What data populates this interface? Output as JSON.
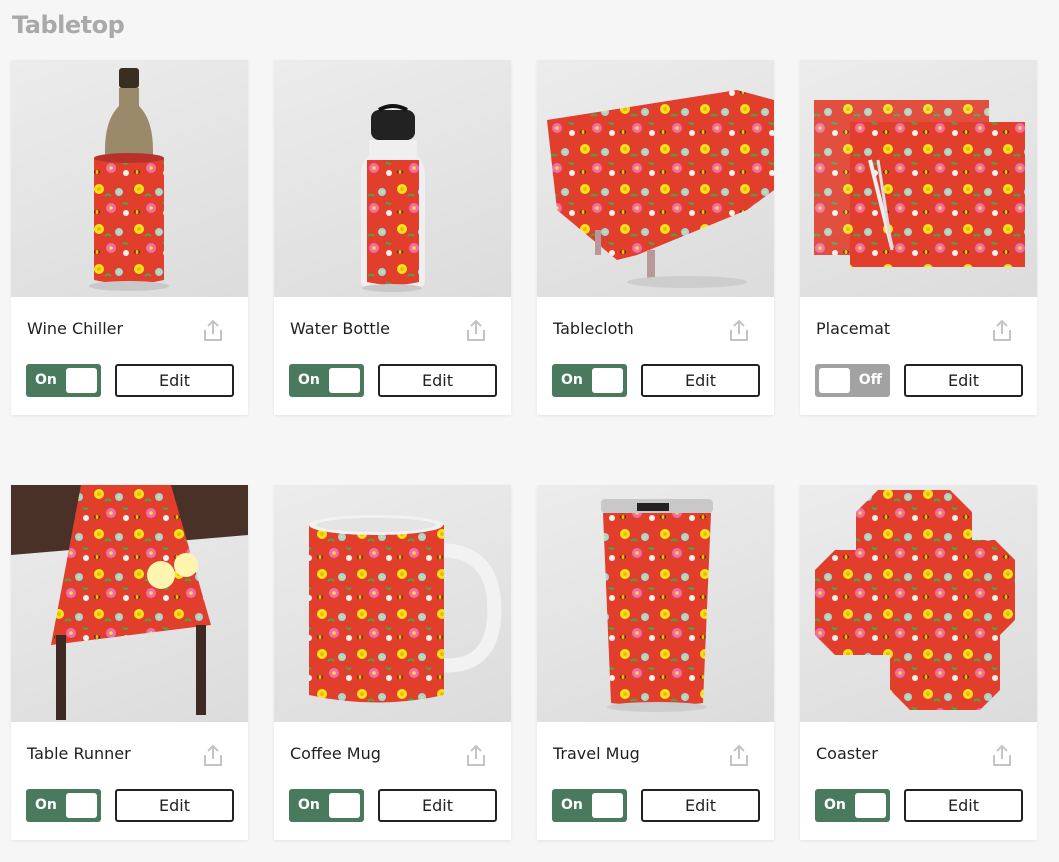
{
  "section": {
    "title": "Tabletop"
  },
  "colors": {
    "toggle_on": "#4a7a5e",
    "toggle_off": "#a2a2a2",
    "pattern_red": "#e13e2c",
    "pattern_yellow": "#f5e41a"
  },
  "products": [
    {
      "name": "Wine Chiller",
      "toggle": "On",
      "enabled": true,
      "edit_label": "Edit",
      "share_icon": "share-icon"
    },
    {
      "name": "Water Bottle",
      "toggle": "On",
      "enabled": true,
      "edit_label": "Edit",
      "share_icon": "share-icon"
    },
    {
      "name": "Tablecloth",
      "toggle": "On",
      "enabled": true,
      "edit_label": "Edit",
      "share_icon": "share-icon"
    },
    {
      "name": "Placemat",
      "toggle": "Off",
      "enabled": false,
      "edit_label": "Edit",
      "share_icon": "share-icon"
    },
    {
      "name": "Table Runner",
      "toggle": "On",
      "enabled": true,
      "edit_label": "Edit",
      "share_icon": "share-icon"
    },
    {
      "name": "Coffee Mug",
      "toggle": "On",
      "enabled": true,
      "edit_label": "Edit",
      "share_icon": "share-icon"
    },
    {
      "name": "Travel Mug",
      "toggle": "On",
      "enabled": true,
      "edit_label": "Edit",
      "share_icon": "share-icon"
    },
    {
      "name": "Coaster",
      "toggle": "On",
      "enabled": true,
      "edit_label": "Edit",
      "share_icon": "share-icon"
    }
  ]
}
